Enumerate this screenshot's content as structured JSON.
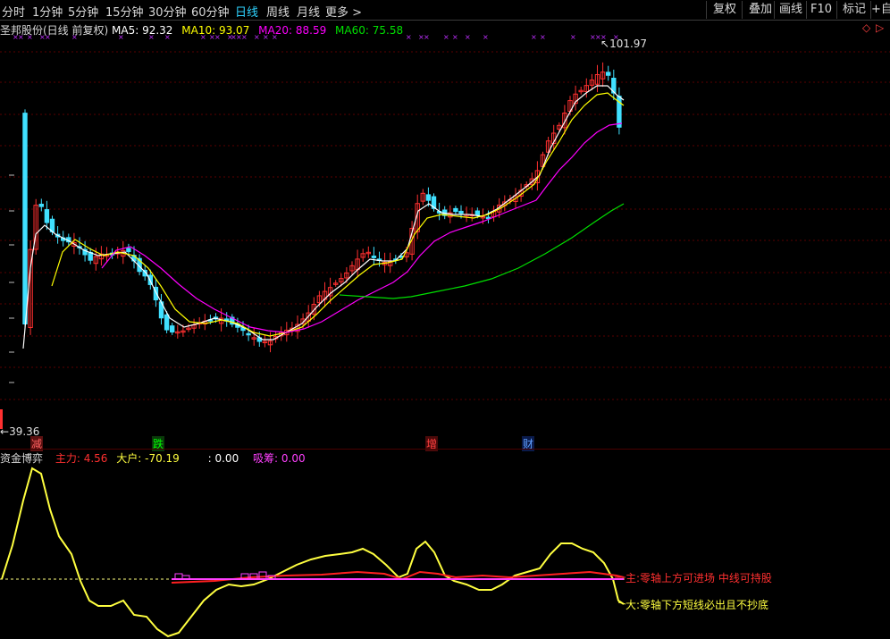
{
  "toolbar": {
    "periods": [
      {
        "label": "分时",
        "active": false
      },
      {
        "label": "1分钟",
        "active": false
      },
      {
        "label": "5分钟",
        "active": false
      },
      {
        "label": "15分钟",
        "active": false
      },
      {
        "label": "30分钟",
        "active": false
      },
      {
        "label": "60分钟",
        "active": false
      },
      {
        "label": "日线",
        "active": true
      },
      {
        "label": "周线",
        "active": false
      },
      {
        "label": "月线",
        "active": false
      },
      {
        "label": "更多 >",
        "active": false
      }
    ],
    "right_buttons": [
      "复权",
      "叠加",
      "画线",
      "F10",
      "标记",
      "+自选"
    ]
  },
  "legend": {
    "title": "圣邦股份(日线 前复权)",
    "ma5_label": "MA5: ",
    "ma5_value": "92.32",
    "ma10_label": "MA10: ",
    "ma10_value": "93.07",
    "ma20_label": "MA20: ",
    "ma20_value": "88.59",
    "ma60_label": "MA60: ",
    "ma60_value": "75.58",
    "colors": {
      "title": "#d8d8d8",
      "ma5": "#ffffff",
      "ma10": "#ffff00",
      "ma20": "#ff00ff",
      "ma60": "#00e000"
    }
  },
  "price_chart": {
    "high_label": "101.97",
    "low_label": "39.36",
    "events": [
      {
        "label": "减",
        "color": "#ff6060"
      },
      {
        "label": "跌",
        "color": "#00ff00"
      },
      {
        "label": "增",
        "color": "#ff4040"
      },
      {
        "label": "财",
        "color": "#60a0ff"
      }
    ],
    "markers": "×"
  },
  "indicator": {
    "title": "资金博弈",
    "main_label": "主力: ",
    "main_value": "4.56",
    "big_label": "大户: ",
    "big_value": "-70.19",
    "blank_label": ": ",
    "blank_value": "0.00",
    "absorb_label": "吸筹: ",
    "absorb_value": "0.00",
    "note_main": "主:零轴上方可进场 中线可持股",
    "note_big": "大:零轴下方短线必出且不抄底",
    "colors": {
      "main": "#ff3030",
      "big": "#ffff40",
      "absorb": "#ff40ff"
    }
  },
  "chart_data": {
    "type": "line",
    "title": "圣邦股份(日线 前复权)",
    "series": [
      {
        "name": "MA5",
        "last": 92.32
      },
      {
        "name": "MA10",
        "last": 93.07
      },
      {
        "name": "MA20",
        "last": 88.59
      },
      {
        "name": "MA60",
        "last": 75.58
      }
    ],
    "period_high": 101.97,
    "period_low": 39.36,
    "indicator": {
      "name": "资金博弈",
      "主力": 4.56,
      "大户": -70.19,
      "吸筹": 0.0
    }
  }
}
